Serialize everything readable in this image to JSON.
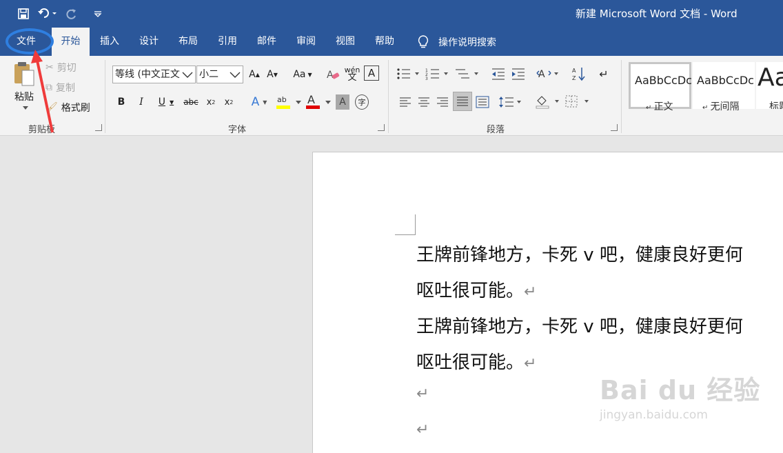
{
  "window": {
    "title": "新建 Microsoft Word 文档  -  Word"
  },
  "qat": {
    "save": "save-icon",
    "undo": "undo-icon",
    "redo": "redo-icon",
    "customize": "customize-icon"
  },
  "tabs": [
    {
      "label": "文件"
    },
    {
      "label": "开始"
    },
    {
      "label": "插入"
    },
    {
      "label": "设计"
    },
    {
      "label": "布局"
    },
    {
      "label": "引用"
    },
    {
      "label": "邮件"
    },
    {
      "label": "审阅"
    },
    {
      "label": "视图"
    },
    {
      "label": "帮助"
    }
  ],
  "tellme": {
    "label": "操作说明搜索",
    "icon": "lightbulb-icon"
  },
  "clipboard": {
    "paste": "粘贴",
    "cut": "剪切",
    "copy": "复制",
    "format_painter": "格式刷",
    "label": "剪贴板"
  },
  "font": {
    "name": "等线 (中文正文",
    "size": "小二",
    "change_case": "Aa",
    "phonetic": "wén",
    "label": "字体"
  },
  "paragraph": {
    "label": "段落"
  },
  "styles": [
    {
      "sample": "AaBbCcDc",
      "name": "正文"
    },
    {
      "sample": "AaBbCcDc",
      "name": "无间隔"
    },
    {
      "sample": "Aa",
      "name": "标题"
    }
  ],
  "document": {
    "lines": [
      "王牌前锋地方，卡死 v 吧，健康良好更何",
      "呕吐很可能。",
      "王牌前锋地方，卡死 v 吧，健康良好更何",
      "呕吐很可能。"
    ],
    "para_mark": "↵"
  },
  "watermark": {
    "main": "Bai du 经验",
    "sub": "jingyan.baidu.com"
  },
  "colors": {
    "brand": "#2b579a",
    "highlight_circle": "#2f7fe0",
    "arrow": "#ef3b3b",
    "ribbon": "#f3f3f3"
  }
}
